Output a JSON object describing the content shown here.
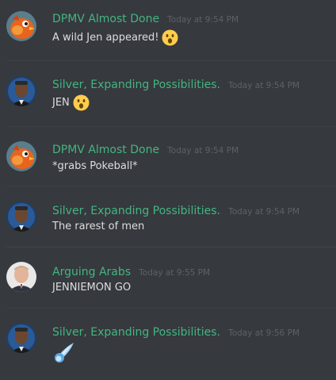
{
  "messages": [
    {
      "username": "DPMV Almost Done",
      "timestamp": "Today at 9:54 PM",
      "text": "A wild Jen appeared!",
      "emoji": "hushed-face",
      "avatar": "orange-bird-avatar"
    },
    {
      "username": "Silver, Expanding Possibilities.",
      "timestamp": "Today at 9:54 PM",
      "text": "JEN",
      "emoji": "hushed-face",
      "avatar": "man-portrait-avatar"
    },
    {
      "username": "DPMV Almost Done",
      "timestamp": "Today at 9:54 PM",
      "text": "*grabs Pokeball*",
      "emoji": "",
      "avatar": "orange-bird-avatar"
    },
    {
      "username": "Silver, Expanding Possibilities.",
      "timestamp": "Today at 9:54 PM",
      "text": "The rarest of men",
      "emoji": "",
      "avatar": "man-portrait-avatar"
    },
    {
      "username": "Arguing Arabs",
      "timestamp": "Today at 9:55 PM",
      "text": "JENNIEMON GO",
      "emoji": "",
      "avatar": "man-suit-avatar"
    },
    {
      "username": "Silver, Expanding Possibilities.",
      "timestamp": "Today at 9:56 PM",
      "text": "",
      "emoji": "comet",
      "avatar": "man-portrait-avatar"
    }
  ],
  "colors": {
    "background": "#36393e",
    "username": "#43b581",
    "text": "#dcddde",
    "timestamp": "#5e6166",
    "divider": "#3e4147"
  }
}
